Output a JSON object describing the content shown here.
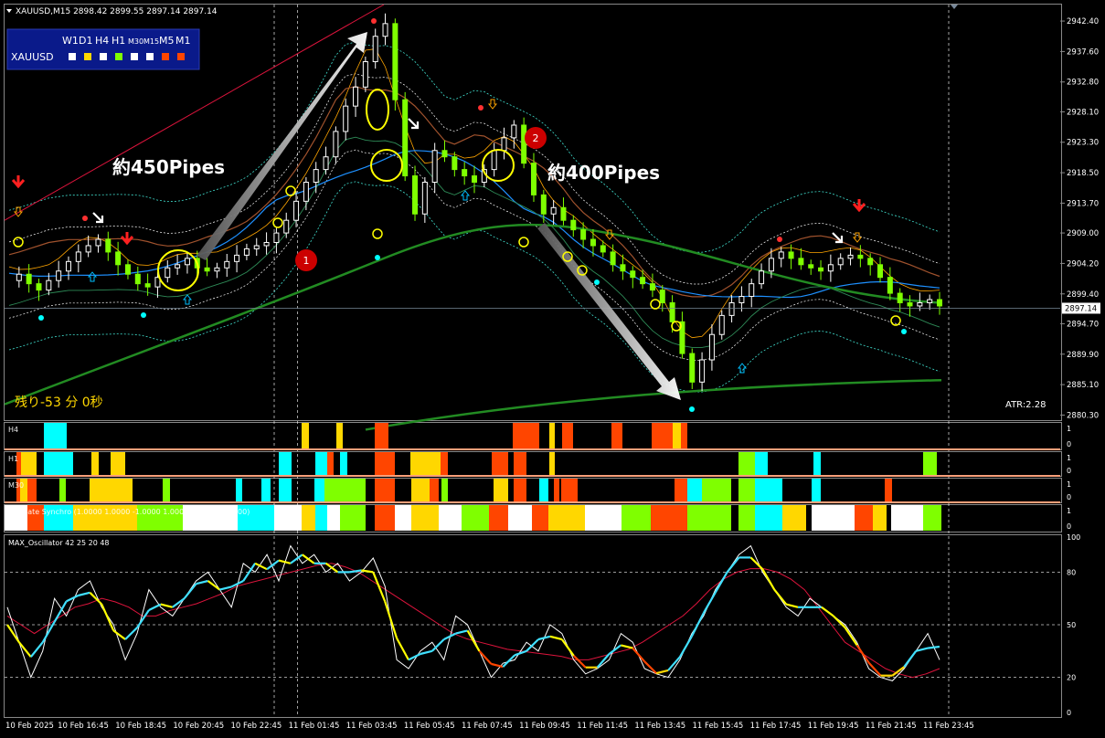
{
  "header": {
    "symbol_text": "XAUUSD,M15  2898.42 2899.55 2897.14 2897.14"
  },
  "timeframe_panel": {
    "labels": [
      "W1",
      "D1",
      "H4",
      "H1",
      "M30",
      "M15",
      "M5",
      "M1"
    ],
    "symbol": "XAUUSD",
    "squares": [
      "#ffffff",
      "#ffd700",
      "#ffffff",
      "#7fff00",
      "#ffffff",
      "#ffffff",
      "#ff4500",
      "#ff4500"
    ]
  },
  "annotations": {
    "up_move": "約450Pipes",
    "down_move": "約400Pipes",
    "badge1": "1",
    "badge2": "2",
    "countdown": "残り-53 分 0秒",
    "atr": "ATR:2.28",
    "current_price_label": "2897.14"
  },
  "colors": {
    "bull_candle": "#ffffff",
    "bear_candle": "#7fff00",
    "grid": "#ffffff",
    "badge": "#cc0000",
    "ma_blue": "#1e90ff",
    "ma_green": "#228b22",
    "ma_brown": "#a0522d"
  },
  "chart_data": [
    {
      "type": "candlestick",
      "symbol": "XAUUSD",
      "timeframe": "M15",
      "ylim": [
        2879.5,
        2945.0
      ],
      "y_ticks": [
        "2942.40",
        "2937.60",
        "2932.80",
        "2928.10",
        "2923.30",
        "2918.50",
        "2913.70",
        "2909.00",
        "2904.20",
        "2899.40",
        "2894.70",
        "2889.90",
        "2885.10",
        "2880.30"
      ],
      "x_ticks": [
        "10 Feb 2025",
        "10 Feb 16:45",
        "10 Feb 18:45",
        "10 Feb 20:45",
        "10 Feb 22:45",
        "11 Feb 01:45",
        "11 Feb 03:45",
        "11 Feb 05:45",
        "11 Feb 07:45",
        "11 Feb 09:45",
        "11 Feb 11:45",
        "11 Feb 13:45",
        "11 Feb 15:45",
        "11 Feb 17:45",
        "11 Feb 19:45",
        "11 Feb 21:45",
        "11 Feb 23:45"
      ],
      "close_path": [
        2901.5,
        2902.5,
        2901.0,
        2900.0,
        2901.5,
        2903.0,
        2904.5,
        2906.0,
        2907.0,
        2908.0,
        2906.0,
        2904.0,
        2902.5,
        2901.0,
        2900.5,
        2902.0,
        2903.5,
        2904.0,
        2905.0,
        2903.5,
        2903.0,
        2903.5,
        2904.5,
        2905.5,
        2906.5,
        2907.0,
        2907.5,
        2909.0,
        2911.0,
        2914.0,
        2917.0,
        2919.0,
        2921.0,
        2925.0,
        2929.0,
        2932.0,
        2936.0,
        2940.0,
        2942.0,
        2930.0,
        2918.0,
        2912.0,
        2917.0,
        2922.0,
        2921.0,
        2919.0,
        2918.0,
        2917.0,
        2919.0,
        2922.0,
        2924.0,
        2926.0,
        2920.0,
        2915.0,
        2912.0,
        2913.0,
        2911.0,
        2909.5,
        2908.0,
        2907.0,
        2906.0,
        2904.0,
        2903.0,
        2902.0,
        2901.0,
        2900.0,
        2898.0,
        2895.0,
        2890.0,
        2885.5,
        2889.0,
        2893.0,
        2896.0,
        2898.0,
        2899.0,
        2901.0,
        2903.0,
        2905.0,
        2906.0,
        2905.0,
        2904.0,
        2903.5,
        2903.0,
        2904.0,
        2905.0,
        2905.5,
        2905.0,
        2904.0,
        2902.0,
        2899.5,
        2898.0,
        2897.5,
        2898.0,
        2898.5,
        2897.5
      ],
      "current_price": 2897.14
    },
    {
      "type": "heatmap",
      "title": "H4",
      "y_ticks": [
        "1",
        "0"
      ]
    },
    {
      "type": "heatmap",
      "title": "H1",
      "y_ticks": [
        "1",
        "0"
      ]
    },
    {
      "type": "heatmap",
      "title": "M30",
      "y_ticks": [
        "1",
        "0"
      ]
    },
    {
      "type": "heatmap",
      "title": "Ultimate Synchro (1.0000 1.0000 -1.0000 1.0000 1.0000 -1.0000)",
      "y_ticks": [
        "1",
        "0"
      ]
    },
    {
      "type": "line",
      "title": "MAX_Oscillator 42 25 20 48",
      "ylim": [
        0,
        100
      ],
      "y_ticks": [
        "100",
        "80",
        "50",
        "20",
        "0"
      ],
      "series": [
        {
          "values": [
            60,
            40,
            20,
            35,
            65,
            55,
            70,
            75,
            60,
            50,
            30,
            45,
            70,
            60,
            55,
            65,
            75,
            80,
            70,
            60,
            85,
            80,
            90,
            75,
            95,
            85,
            90,
            80,
            85,
            75,
            80,
            88,
            72,
            30,
            25,
            35,
            40,
            30,
            55,
            50,
            35,
            20,
            28,
            30,
            40,
            35,
            50,
            45,
            30,
            22,
            25,
            30,
            45,
            40,
            25,
            22,
            20,
            30,
            45,
            55,
            70,
            80,
            90,
            95,
            80,
            70,
            60,
            55,
            65,
            60,
            55,
            50,
            40,
            25,
            20,
            18,
            25,
            35,
            45,
            30
          ]
        },
        {
          "values": [
            55,
            50,
            45,
            50,
            55,
            60,
            62,
            65,
            63,
            60,
            55,
            55,
            58,
            60,
            62,
            65,
            68,
            72,
            74,
            76,
            78,
            80,
            82,
            84,
            85,
            83,
            80,
            75,
            70,
            65,
            60,
            55,
            50,
            45,
            42,
            40,
            38,
            36,
            35,
            34,
            33,
            32,
            30,
            30,
            32,
            34,
            36,
            40,
            45,
            50,
            55,
            62,
            70,
            76,
            80,
            82,
            82,
            80,
            76,
            70,
            60,
            50,
            40,
            35,
            30,
            25,
            22,
            20,
            22,
            25
          ]
        }
      ]
    }
  ]
}
